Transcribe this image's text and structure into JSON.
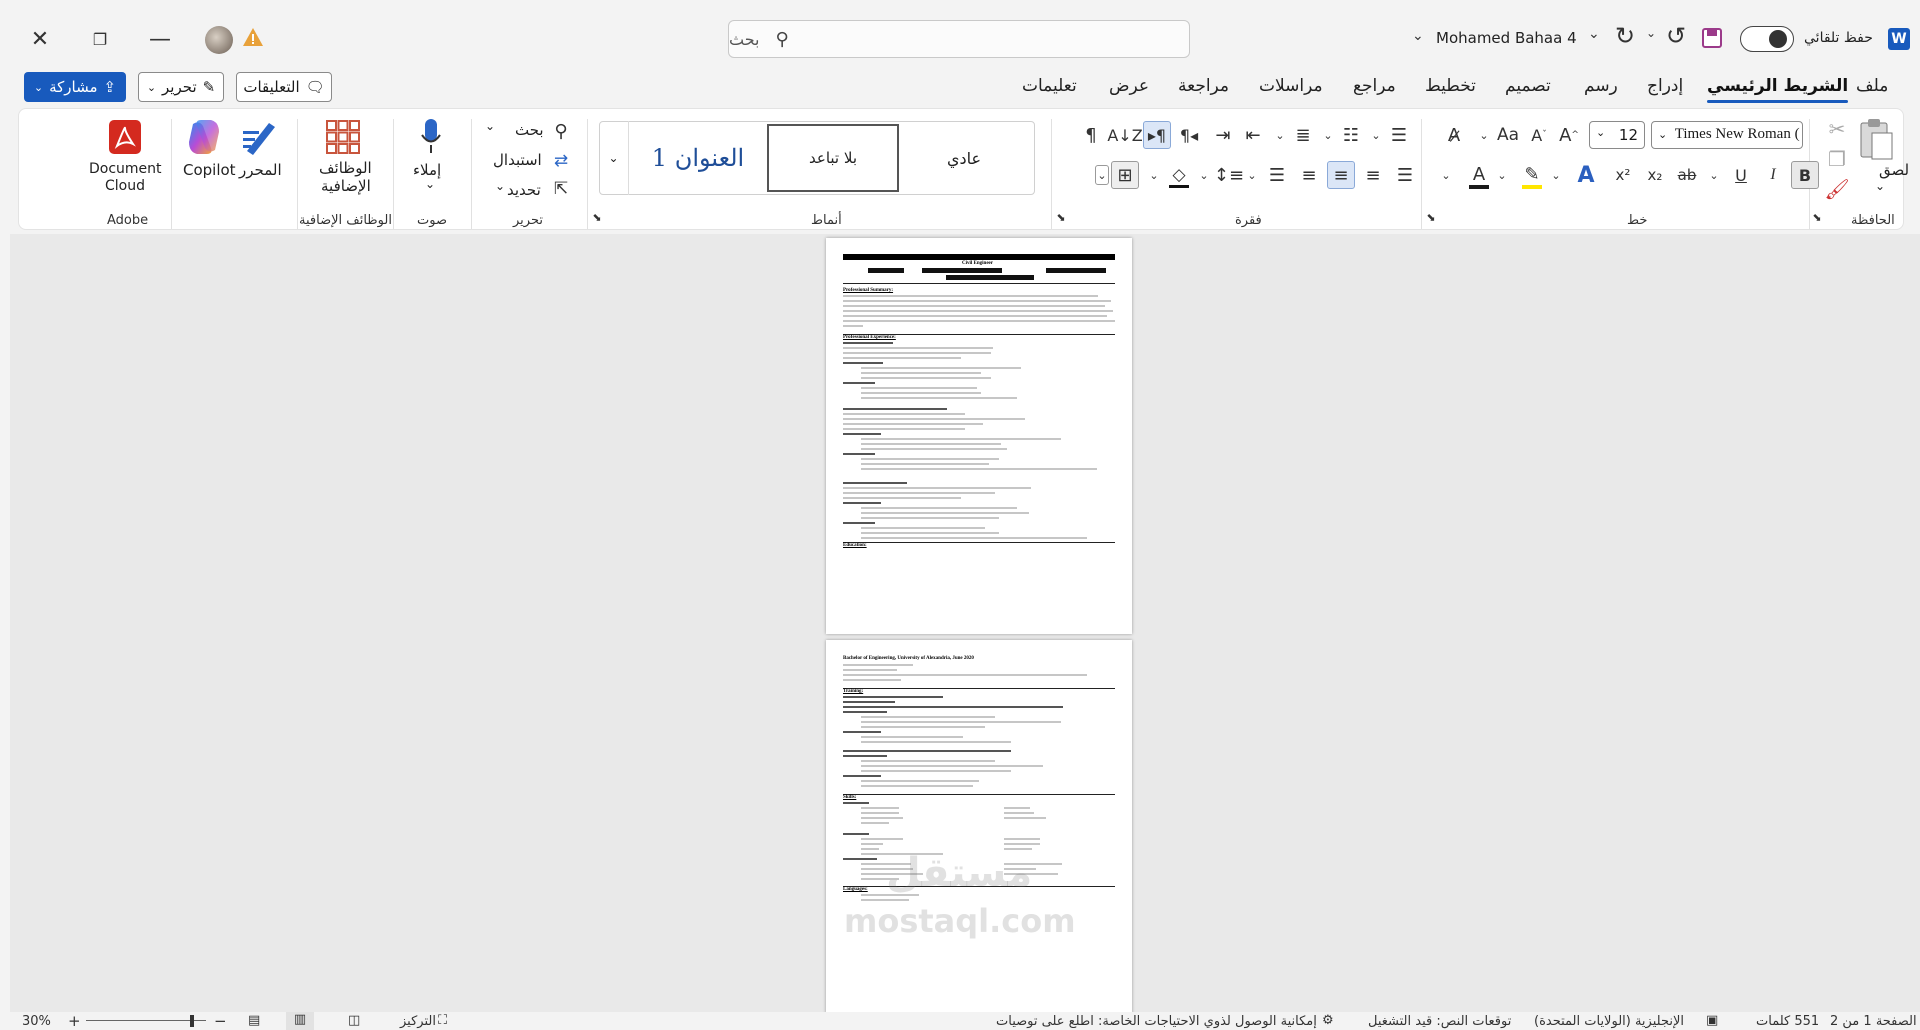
{
  "titlebar": {
    "app_icon": "word-icon",
    "autosave_label": "حفظ تلقائي",
    "user_name": "Mohamed Bahaa 4",
    "search_placeholder": "بحث"
  },
  "menu": {
    "items": [
      "ملف",
      "الشريط الرئيسي",
      "إدراج",
      "رسم",
      "تصميم",
      "تخطيط",
      "مراجع",
      "مراسلات",
      "مراجعة",
      "عرض",
      "تعليمات"
    ],
    "active": "الشريط الرئيسي",
    "comments_label": "التعليقات",
    "edit_label": "تحرير",
    "share_label": "مشاركة"
  },
  "ribbon": {
    "clipboard": {
      "paste": "لصق",
      "group": "الحافظة"
    },
    "font": {
      "name": "Times New Roman (",
      "size": "12",
      "group": "خط",
      "bold": "B",
      "italic": "I",
      "underline": "U",
      "strike": "ab",
      "sub": "x₂",
      "sup": "x²"
    },
    "paragraph": {
      "group": "فقرة"
    },
    "styles": {
      "normal": "عادي",
      "no_spacing": "بلا تباعد",
      "heading1": "العنوان 1",
      "group": "أنماط"
    },
    "editing": {
      "find": "بحث",
      "replace": "استبدال",
      "select": "تحديد",
      "group": "تحرير"
    },
    "voice": {
      "dictate": "إملاء",
      "group": "صوت"
    },
    "addins": {
      "label": "الوظائف الإضافية",
      "label2": "الإضافية",
      "label1": "الوظائف",
      "group": "الوظائف الإضافية"
    },
    "editor": {
      "label": "المحرر"
    },
    "copilot": {
      "label": "Copilot"
    },
    "adobe": {
      "label1": "Document",
      "label2": "Cloud",
      "group": "Adobe"
    }
  },
  "document": {
    "page1_title": "Civil Engineer",
    "page1_sections": [
      "Professional Summary:",
      "Professional Experience:",
      "Education:"
    ],
    "page2_sections": [
      "Training:",
      "Skills:",
      "Languages:"
    ],
    "page2_edu": "Bachelor of Engineering, University of Alexandria, June 2020",
    "watermark_text": "mostaql.com"
  },
  "statusbar": {
    "page": "الصفحة 1 من 2",
    "words": "551 كلمات",
    "language": "الإنجليزية (الولايات المتحدة)",
    "predictions": "توقعات النص: قيد التشغيل",
    "accessibility": "إمكانية الوصول لذوي الاحتياجات الخاصة: اطلع على توصيات",
    "focus": "التركيز",
    "zoom": "30%"
  }
}
